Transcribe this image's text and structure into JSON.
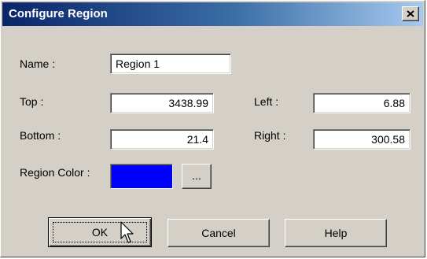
{
  "window": {
    "title": "Configure Region",
    "close_label": "×"
  },
  "fields": {
    "name": {
      "label": "Name :",
      "value": "Region 1"
    },
    "top": {
      "label": "Top :",
      "value": "3438.99"
    },
    "left": {
      "label": "Left :",
      "value": "6.88"
    },
    "bottom": {
      "label": "Bottom :",
      "value": "21.4"
    },
    "right": {
      "label": "Right :",
      "value": "300.58"
    }
  },
  "region_color": {
    "label": "Region Color :",
    "color": "#0000ff",
    "browse_label": "..."
  },
  "buttons": {
    "ok": "OK",
    "cancel": "Cancel",
    "help": "Help"
  },
  "theme": {
    "titlebar_start": "#0a246a",
    "titlebar_end": "#a6caf0",
    "face": "#d4d0c8"
  }
}
